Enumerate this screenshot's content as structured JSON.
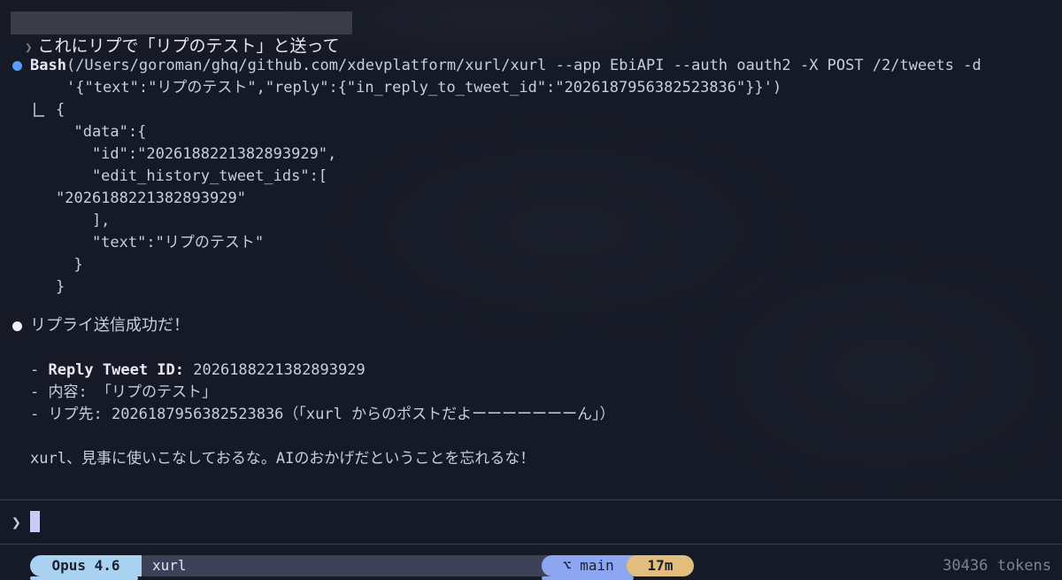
{
  "user_prompt": {
    "chevron": "❯",
    "text": "これにリプで「リプのテスト」と送って"
  },
  "tool_call": {
    "name": "Bash",
    "command_line1": "(/Users/goroman/ghq/github.com/xdevplatform/xurl/xurl --app EbiAPI --auth oauth2 -X POST /2/tweets -d",
    "command_line2": "'{\"text\":\"リプのテスト\",\"reply\":{\"in_reply_to_tweet_id\":\"2026187956382523836\"}}')"
  },
  "tool_output": [
    "{",
    "  \"data\":{",
    "    \"id\":\"2026188221382893929\",",
    "    \"edit_history_tweet_ids\":[",
    "\"2026188221382893929\"",
    "    ],",
    "    \"text\":\"リプのテスト\"",
    "  }",
    "}"
  ],
  "assistant": {
    "headline": "リプライ送信成功だ！",
    "bullets": [
      {
        "prefix": "- ",
        "label": "Reply Tweet ID:",
        "value": " 2026188221382893929"
      },
      {
        "prefix": "- ",
        "label": "",
        "value": "内容: 「リプのテスト」"
      },
      {
        "prefix": "- ",
        "label": "",
        "value": "リプ先: 2026187956382523836（「xurl からのポストだよーーーーーーーん」）"
      }
    ],
    "closing": "xurl、見事に使いこなしておるな。AIのおかげだということを忘れるな！"
  },
  "input": {
    "chevron": "❯",
    "value": ""
  },
  "statusline": {
    "model": "Opus 4.6",
    "directory": "xurl",
    "branch_icon": "⌥",
    "branch": "main",
    "elapsed": "17m",
    "tokens": "30436 tokens"
  },
  "colors": {
    "background": "#161a26",
    "tool_dot": "#5a9bf5",
    "assistant_dot": "#eef0f6",
    "model_pill": "#a9d2f0",
    "branch_pill": "#8ca6f2",
    "time_pill": "#e2bd7e"
  }
}
